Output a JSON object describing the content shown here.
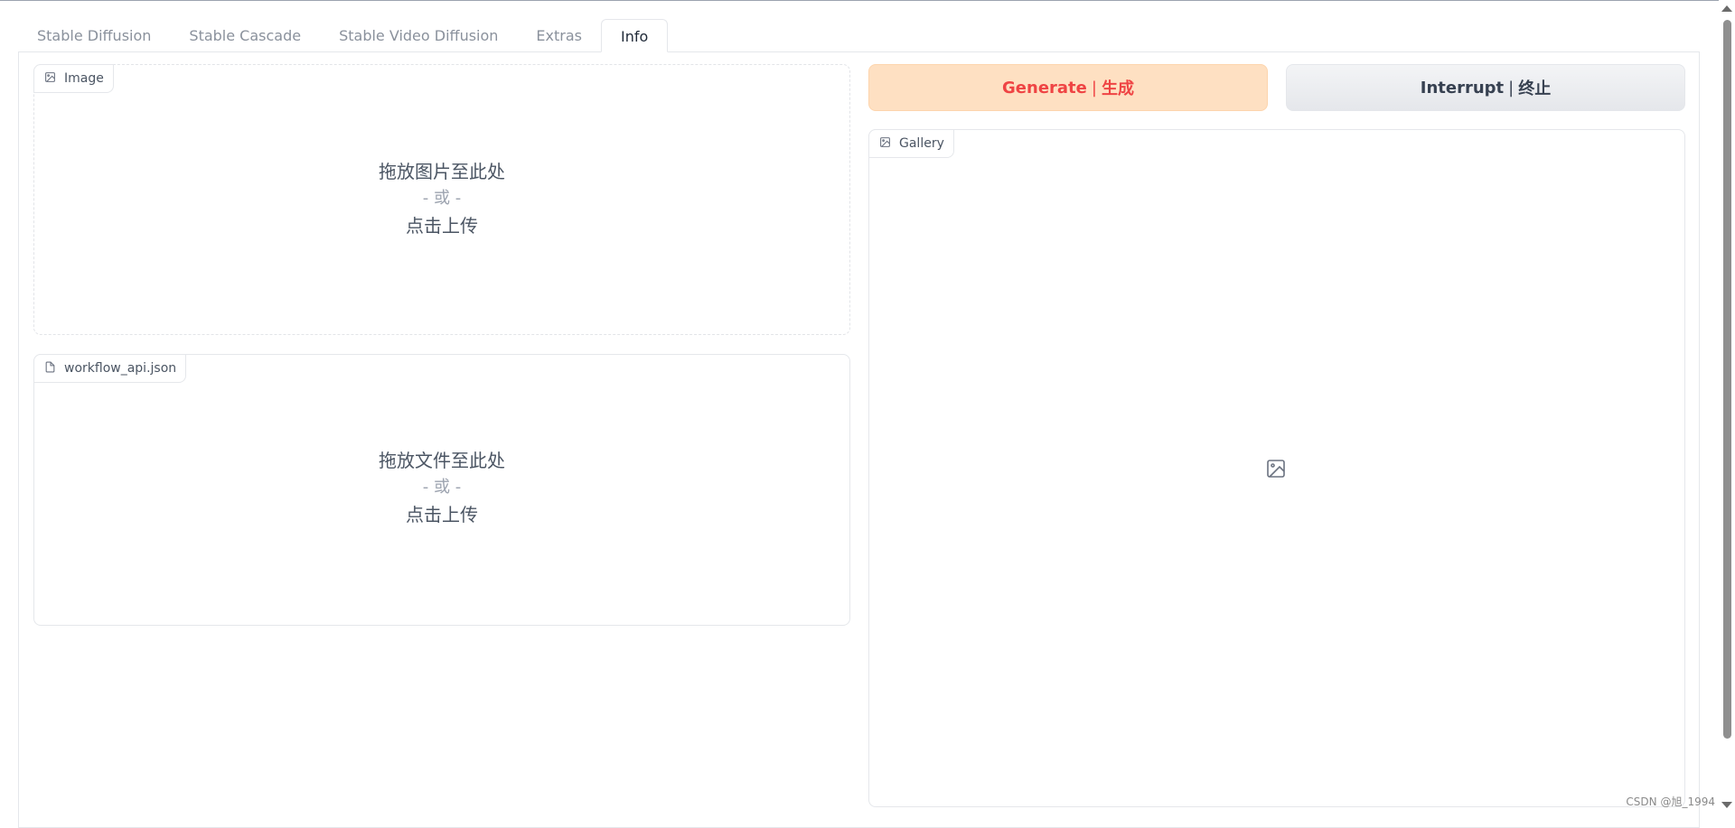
{
  "tabs": [
    {
      "label": "Stable Diffusion",
      "active": false
    },
    {
      "label": "Stable Cascade",
      "active": false
    },
    {
      "label": "Stable Video Diffusion",
      "active": false
    },
    {
      "label": "Extras",
      "active": false
    },
    {
      "label": "Info",
      "active": true
    }
  ],
  "image_upload": {
    "label": "Image",
    "icon": "image-icon",
    "drop_text": "拖放图片至此处",
    "or_text": "- 或 -",
    "click_text": "点击上传"
  },
  "file_upload": {
    "label": "workflow_api.json",
    "icon": "file-icon",
    "drop_text": "拖放文件至此处",
    "or_text": "- 或 -",
    "click_text": "点击上传"
  },
  "buttons": {
    "generate_en": "Generate",
    "generate_zh": "生成",
    "interrupt_en": "Interrupt",
    "interrupt_zh": "终止",
    "separator": "|"
  },
  "gallery": {
    "label": "Gallery",
    "icon": "image-icon",
    "placeholder_icon": "image-placeholder-icon"
  },
  "watermark": "CSDN @旭_1994",
  "colors": {
    "generate_bg": "#fee0c2",
    "generate_text": "#ef4444",
    "interrupt_bg": "#e5e7eb",
    "active_tab_text": "#1f2937"
  }
}
